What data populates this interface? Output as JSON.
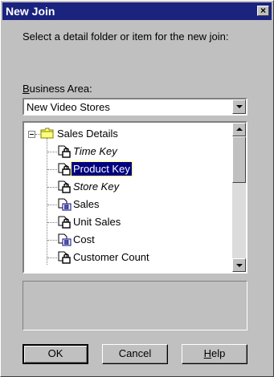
{
  "window": {
    "title": "New Join",
    "close_label": "×"
  },
  "instructions": "Select a detail folder or item for the new join:",
  "business_area": {
    "label_prefix": "B",
    "label_rest": "usiness Area:",
    "selected": "New Video Stores"
  },
  "tree": {
    "folder": {
      "label": "Sales Details",
      "icon": "folder-icon",
      "expanded": true
    },
    "items": [
      {
        "label": "Time Key",
        "icon": "join-item-icon",
        "italic": true,
        "selected": false
      },
      {
        "label": "Product Key",
        "icon": "join-item-icon",
        "italic": false,
        "selected": true
      },
      {
        "label": "Store Key",
        "icon": "join-item-icon",
        "italic": true,
        "selected": false
      },
      {
        "label": "Sales",
        "icon": "measure-item-icon",
        "italic": false,
        "selected": false
      },
      {
        "label": "Unit Sales",
        "icon": "join-item-icon",
        "italic": false,
        "selected": false
      },
      {
        "label": "Cost",
        "icon": "measure-item-icon",
        "italic": false,
        "selected": false
      },
      {
        "label": "Customer Count",
        "icon": "join-item-icon",
        "italic": false,
        "selected": false
      }
    ]
  },
  "buttons": {
    "ok": "OK",
    "cancel": "Cancel",
    "help_prefix": "H",
    "help_rest": "elp"
  },
  "colors": {
    "titlebar": "#1a237e",
    "selection": "#000080",
    "face": "#c0c0c0"
  }
}
